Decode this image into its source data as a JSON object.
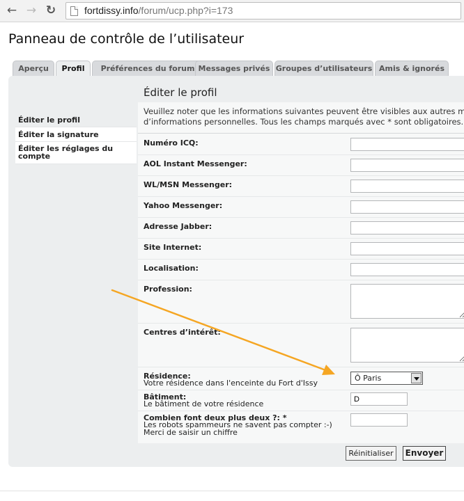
{
  "browser": {
    "url_host": "fortdissy.info",
    "url_path": "/forum/ucp.php?i=173"
  },
  "page_title": "Panneau de contrôle de l’utilisateur",
  "tabs": [
    {
      "label": "Aperçu"
    },
    {
      "label": "Profil"
    },
    {
      "label": "Préférences du forum"
    },
    {
      "label": "Messages privés"
    },
    {
      "label": "Groupes d’utilisateurs"
    },
    {
      "label": "Amis & ignorés"
    }
  ],
  "sidebar": {
    "items": [
      {
        "label": "Éditer le profil"
      },
      {
        "label": "Éditer la signature"
      },
      {
        "label": "Éditer les réglages du compte"
      }
    ]
  },
  "form": {
    "title": "Éditer le profil",
    "notice_line1": "Veuillez noter que les informations suivantes peuvent être visibles aux autres m",
    "notice_line2": "d’informations personnelles. Tous les champs marqués avec * sont obligatoires.",
    "fields": {
      "icq": {
        "label": "Numéro ICQ:",
        "value": ""
      },
      "aim": {
        "label": "AOL Instant Messenger:",
        "value": ""
      },
      "msn": {
        "label": "WL/MSN Messenger:",
        "value": ""
      },
      "yahoo": {
        "label": "Yahoo Messenger:",
        "value": ""
      },
      "jabber": {
        "label": "Adresse Jabber:",
        "value": ""
      },
      "website": {
        "label": "Site Internet:",
        "value": ""
      },
      "location": {
        "label": "Localisation:",
        "value": ""
      },
      "profession": {
        "label": "Profession:",
        "value": ""
      },
      "interests": {
        "label": "Centres d’intérêt:",
        "value": ""
      },
      "residence": {
        "label": "Résidence:",
        "help": "Votre résidence dans l'enceinte du Fort d'Issy",
        "selected": "Ô Paris"
      },
      "building": {
        "label": "Bâtiment:",
        "help": "Le bâtiment de votre résidence",
        "value": "D"
      },
      "captcha": {
        "label": "Combien font deux plus deux ?: *",
        "help1": "Les robots spammeurs ne savent pas compter :-)",
        "help2": "Merci de saisir un chiffre",
        "value": ""
      }
    },
    "buttons": {
      "reset": "Réinitialiser",
      "submit": "Envoyer"
    }
  },
  "colors": {
    "annotation_arrow": "#f5a623",
    "panel_bg": "#eceeef"
  }
}
